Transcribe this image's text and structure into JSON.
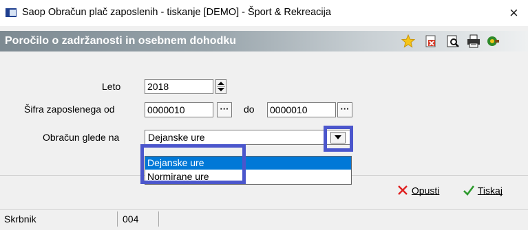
{
  "window": {
    "title": "Saop Obračun plač zaposlenih -  tiskanje [DEMO] - Šport & Rekreacija",
    "close_glyph": "×"
  },
  "header": {
    "title": "Poročilo o zadržanosti in osebnem dohodku",
    "icons": [
      "star-icon",
      "cancel-document-icon",
      "print-preview-icon",
      "printer-icon",
      "exit-icon"
    ]
  },
  "form": {
    "year": {
      "label": "Leto",
      "value": "2018"
    },
    "employee_code": {
      "label": "Šifra zaposlenega od",
      "from_value": "0000010",
      "to_label": "do",
      "to_value": "0000010",
      "browse_glyph": "···"
    },
    "calculation": {
      "label": "Obračun glede na",
      "value": "Dejanske ure",
      "options": [
        "Dejanske ure",
        "Normirane ure"
      ],
      "selected_index": 0
    }
  },
  "buttons": {
    "cancel_label": "Opusti",
    "print_label": "Tiskaj"
  },
  "statusbar": {
    "left": "Skrbnik",
    "code": "004"
  },
  "colors": {
    "highlight_border": "#4b56cc",
    "selection": "#0078d7",
    "header_text": "#ffffff"
  }
}
